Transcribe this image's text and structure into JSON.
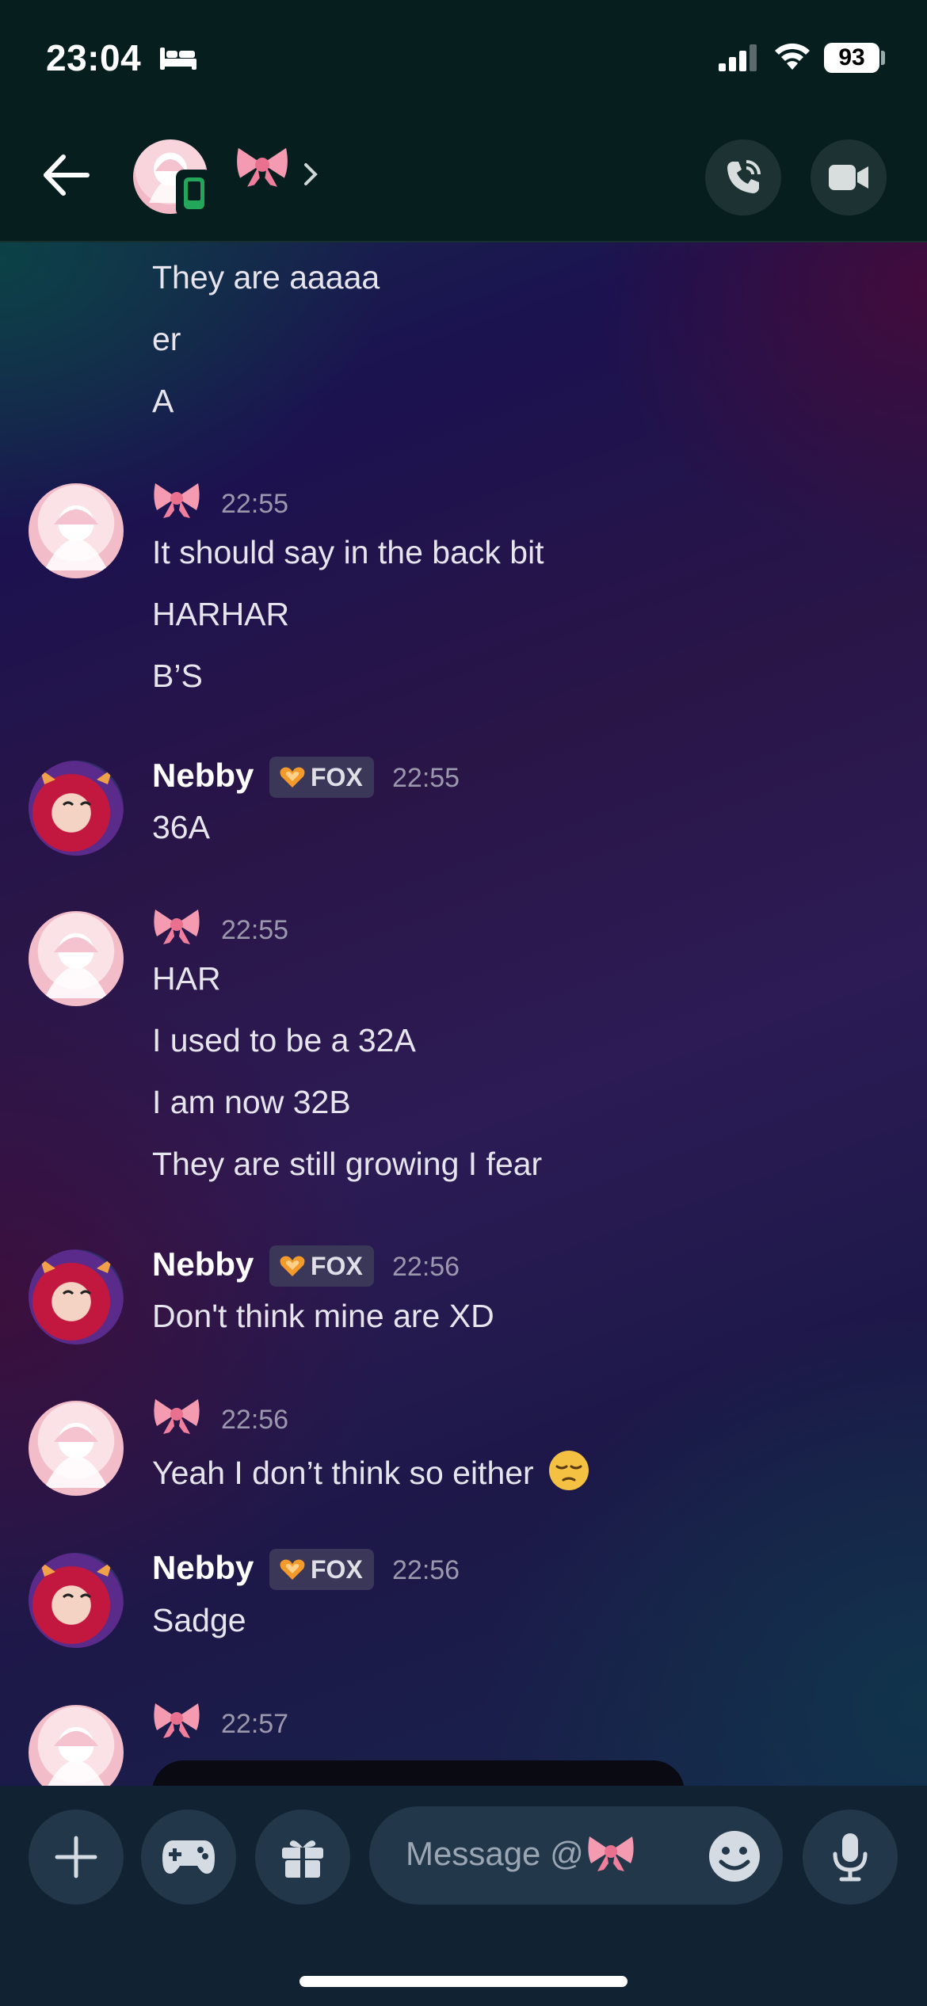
{
  "status_bar": {
    "time": "23:04",
    "battery": "93",
    "icons": [
      "bed-icon",
      "signal-icon",
      "wifi-icon",
      "battery-icon"
    ]
  },
  "header": {
    "name_emoji": "🎀",
    "presence": "mobile-online",
    "actions": [
      "voice-call-icon",
      "video-call-icon"
    ]
  },
  "messages": {
    "group0": {
      "lines": [
        "They are aaaaa",
        "er",
        "A"
      ]
    },
    "group1": {
      "author_emoji": "🎀",
      "time": "22:55",
      "lines": [
        "It should say in the back bit",
        "HARHAR",
        "B’S"
      ]
    },
    "group2": {
      "author": "Nebby",
      "tag": "FOX",
      "time": "22:55",
      "lines": [
        "36A"
      ]
    },
    "group3": {
      "author_emoji": "🎀",
      "time": "22:55",
      "lines": [
        "HAR",
        "I used to be a 32A",
        "I am now 32B",
        "They are still growing I fear"
      ]
    },
    "group4": {
      "author": "Nebby",
      "tag": "FOX",
      "time": "22:56",
      "lines": [
        "Don't think mine are XD"
      ]
    },
    "group5": {
      "author_emoji": "🎀",
      "time": "22:56",
      "lines": [
        "Yeah I don’t think so either"
      ]
    },
    "group6": {
      "author": "Nebby",
      "tag": "FOX",
      "time": "22:56",
      "lines": [
        "Sadge"
      ]
    },
    "group7": {
      "author_emoji": "🎀",
      "time": "22:57"
    }
  },
  "composer": {
    "placeholder": "Message @",
    "placeholder_emoji": "🎀",
    "buttons": [
      "plus-icon",
      "gamepad-icon",
      "gift-icon",
      "emoji-icon",
      "mic-icon"
    ]
  },
  "colors": {
    "header_bg": "#071e1e",
    "composer_bg": "#112233",
    "button_bg": "#23374a",
    "online_green": "#23a55a",
    "tag_bg": "#3a3759"
  }
}
